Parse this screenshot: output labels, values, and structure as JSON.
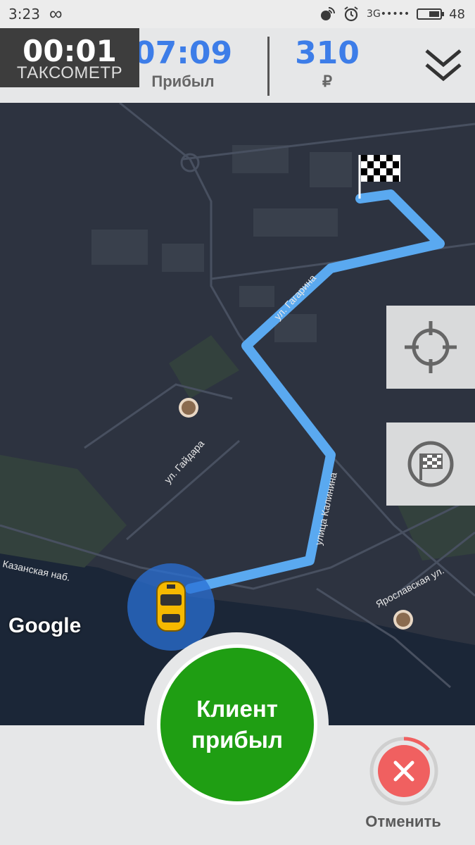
{
  "status_bar": {
    "time": "3:23",
    "infinity_glyph": "∞",
    "network": "3G",
    "battery": "48"
  },
  "header": {
    "taximeter_time": "00:01",
    "taximeter_label": "ТАКСОМЕТР",
    "arrival_time": "07:09",
    "arrival_label": "Прибыл",
    "fare": "310",
    "currency": "₽"
  },
  "map": {
    "streets": {
      "gagarina": "ул. Гагарина",
      "gaidara": "ул. Гайдара",
      "kalinina": "улица Калинина",
      "kazanskaya": "Казанская наб.",
      "yaroslavskaya": "Ярославская ул."
    },
    "attribution": "Google",
    "route_color": "#5aa9f0",
    "car_color": "#f6b900"
  },
  "actions": {
    "arrived_label": "Клиент прибыл",
    "arrived_color": "#1f9e13",
    "cancel_label": "Отменить",
    "cancel_color": "#f06060"
  },
  "icons": {
    "connectivity": "infinity-icon",
    "collapse": "double-chevron-down-icon",
    "locate": "crosshair-icon",
    "finish": "checkered-flag-icon",
    "cancel": "close-icon"
  }
}
